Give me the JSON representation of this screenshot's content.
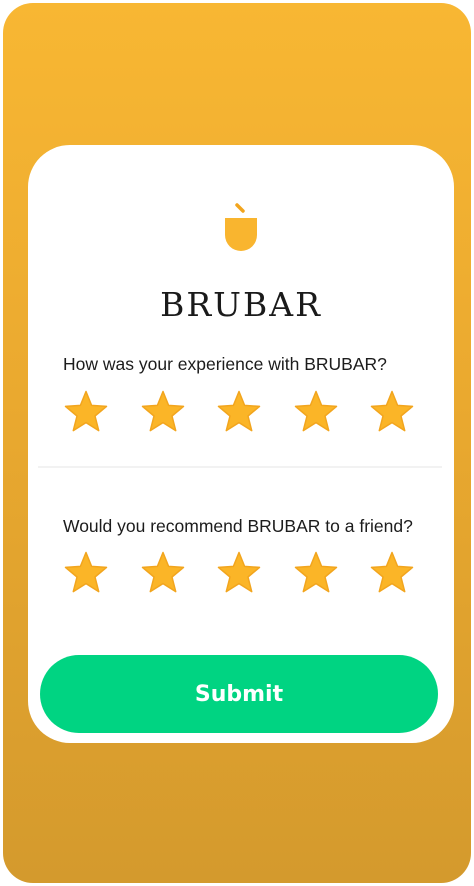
{
  "brand": {
    "name": "BRUBAR",
    "logo_icon": "cup-icon"
  },
  "rating_experience": {
    "question": "How was your experience with BRUBAR?",
    "max_stars": 5,
    "rating": 5
  },
  "rating_recommend": {
    "question": "Would you recommend BRUBAR to a friend?",
    "max_stars": 5,
    "rating": 5
  },
  "submit": {
    "label": "Submit"
  },
  "colors": {
    "background_top": "#F8B733",
    "background_bottom": "#D49A2D",
    "card": "#FFFFFF",
    "star_fill": "#FBB527",
    "star_stroke": "#F2A51E",
    "submit_button": "#00D482",
    "text": "#1C1C1C"
  }
}
